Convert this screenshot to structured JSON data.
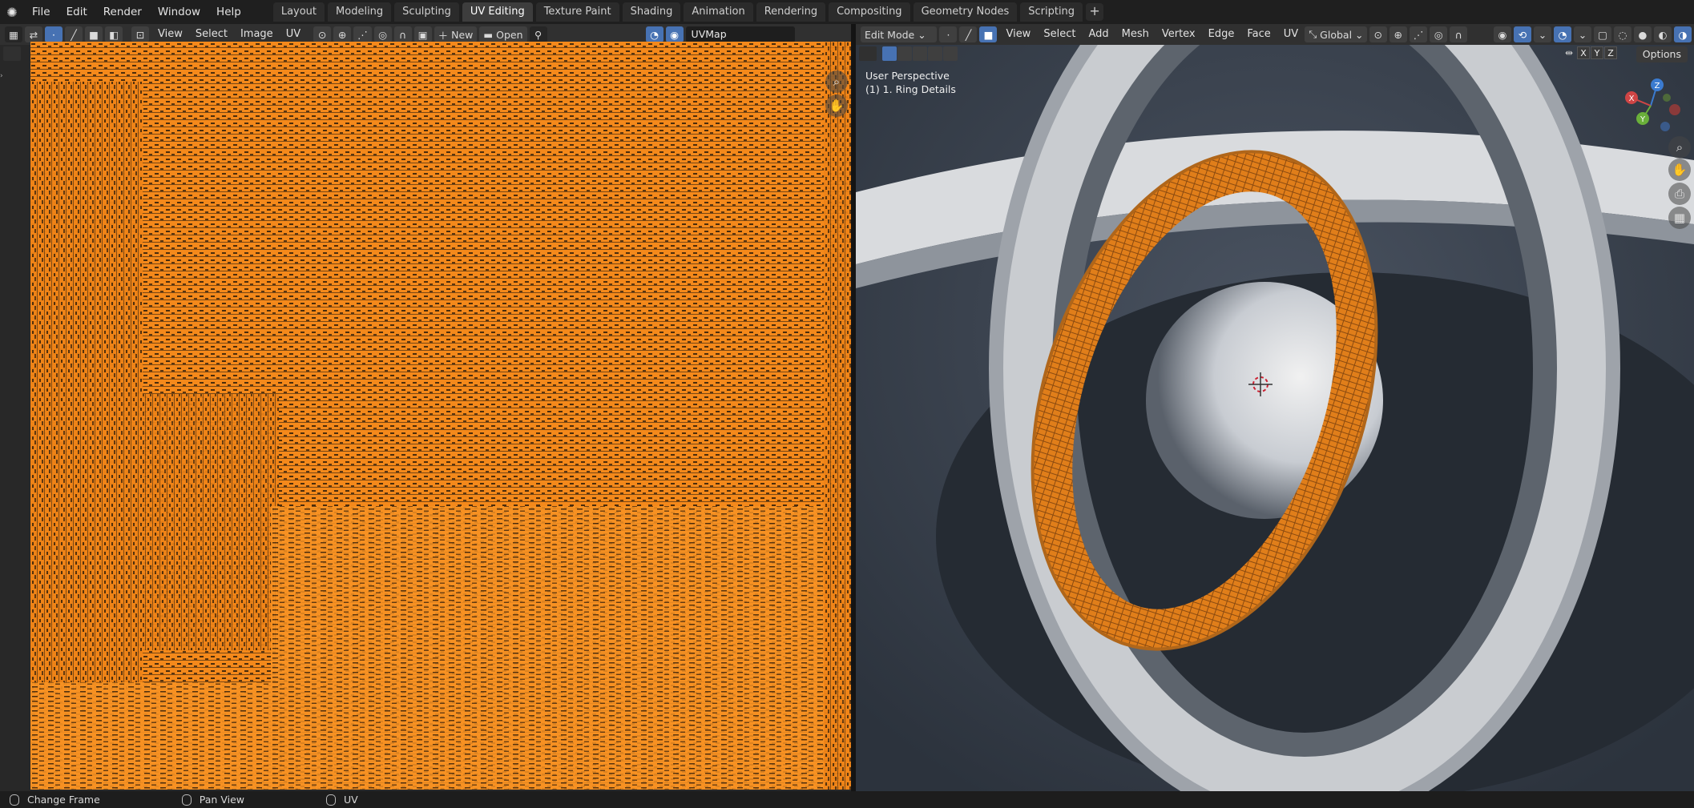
{
  "topbar": {
    "menus": [
      "File",
      "Edit",
      "Render",
      "Window",
      "Help"
    ],
    "workspace_tabs": [
      {
        "label": "Layout",
        "active": false
      },
      {
        "label": "Modeling",
        "active": false
      },
      {
        "label": "Sculpting",
        "active": false
      },
      {
        "label": "UV Editing",
        "active": true
      },
      {
        "label": "Texture Paint",
        "active": false
      },
      {
        "label": "Shading",
        "active": false
      },
      {
        "label": "Animation",
        "active": false
      },
      {
        "label": "Rendering",
        "active": false
      },
      {
        "label": "Compositing",
        "active": false
      },
      {
        "label": "Geometry Nodes",
        "active": false
      },
      {
        "label": "Scripting",
        "active": false
      }
    ],
    "add_tab": "+"
  },
  "uv_editor": {
    "menus": [
      "View",
      "Select",
      "Image",
      "UV"
    ],
    "new_label": "New",
    "open_label": "Open",
    "uvmap_value": "UVMap"
  },
  "viewport": {
    "mode": "Edit Mode",
    "menus": [
      "View",
      "Select",
      "Add",
      "Mesh",
      "Vertex",
      "Edge",
      "Face",
      "UV"
    ],
    "transform_orientation": "Global",
    "perspective_label": "User Perspective",
    "object_label": "(1) 1. Ring Details",
    "axis_x": "X",
    "axis_y": "Y",
    "axis_z": "Z",
    "options_label": "Options"
  },
  "statusbar": {
    "items": [
      "Change Frame",
      "Pan View",
      "UV"
    ]
  },
  "colors": {
    "uv_orange": "#f4891b",
    "selection_blue": "#4772b3",
    "viewport_bg": "#3b4350"
  }
}
